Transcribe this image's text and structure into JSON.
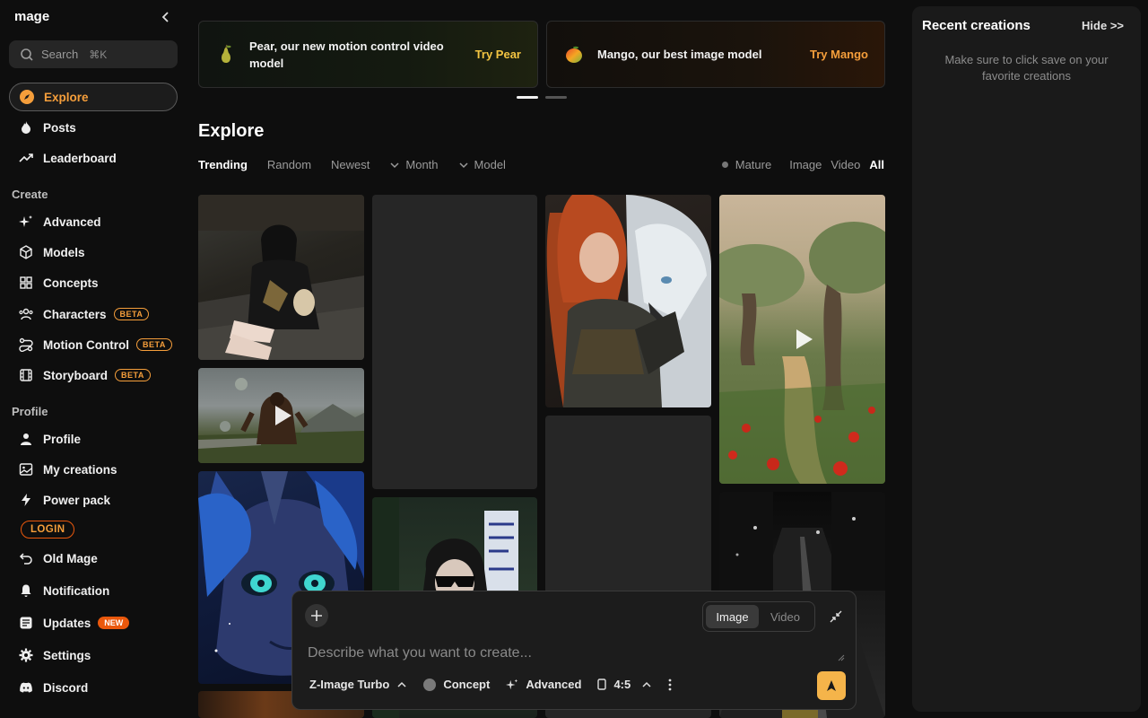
{
  "app": {
    "logo": "mage"
  },
  "search": {
    "placeholder": "Search",
    "shortcut": "⌘K"
  },
  "nav": {
    "explore": "Explore",
    "posts": "Posts",
    "leaderboard": "Leaderboard",
    "create_heading": "Create",
    "advanced": "Advanced",
    "models": "Models",
    "concepts": "Concepts",
    "characters": "Characters",
    "motion_control": "Motion Control",
    "storyboard": "Storyboard",
    "beta": "BETA",
    "profile_heading": "Profile",
    "profile": "Profile",
    "my_creations": "My creations",
    "power_pack": "Power pack",
    "login": "LOGIN",
    "old_mage": "Old Mage",
    "notification": "Notification",
    "updates": "Updates",
    "new": "NEW",
    "settings": "Settings",
    "discord": "Discord"
  },
  "banners": [
    {
      "text": "Pear, our new motion control video model",
      "cta": "Try Pear"
    },
    {
      "text": "Mango, our best image model",
      "cta": "Try Mango"
    }
  ],
  "explore": {
    "title": "Explore",
    "sort_tabs": [
      "Trending",
      "Random",
      "Newest"
    ],
    "month": "Month",
    "model": "Model",
    "mature": "Mature",
    "types": [
      "Image",
      "Video",
      "All"
    ]
  },
  "prompt": {
    "mode_image": "Image",
    "mode_video": "Video",
    "placeholder": "Describe what you want to create...",
    "model": "Z-Image Turbo",
    "concept": "Concept",
    "advanced": "Advanced",
    "ratio": "4:5"
  },
  "recent": {
    "title": "Recent creations",
    "hide": "Hide >>",
    "message": "Make sure to click save on your favorite creations"
  },
  "colors": {
    "accent": "#f59e3b",
    "new_badge": "#ea580c",
    "send": "#f5b44a"
  }
}
